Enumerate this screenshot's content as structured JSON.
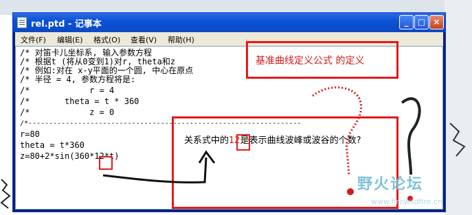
{
  "window": {
    "title": "rel.ptd - 记事本",
    "buttons": {
      "minimize": "_",
      "maximize": "□",
      "close": "×"
    }
  },
  "menu": [
    "文件(F)",
    "编辑(E)",
    "格式(O)",
    "查看(V)",
    "帮助(H)"
  ],
  "editor": {
    "lines": [
      "/* 对笛卡儿坐标系, 输入参数方程",
      "/* 根据t (将从0变到1)对r, theta和z",
      "/* 例如:对在 x-y平面的一个圆, 中心在原点",
      "/* 半径 = 4, 参数方程将是:",
      "/*            r = 4",
      "/*       theta = t * 360",
      "/*            z = 0",
      "/*------------------------------------------------------------------",
      "r=80",
      "theta = t*360",
      "z=80+2*sin(360*12*t)"
    ]
  },
  "annotations": {
    "title_label": "基准曲线定义公式 的定义",
    "note_prefix": "关系式中的",
    "note_highlight": "12",
    "note_suffix": "是表示曲线波峰或波谷的个数?",
    "accent_color": "#e31a1a"
  },
  "watermark": {
    "text": "野火论坛",
    "url": "www.firewildfire.cn"
  }
}
